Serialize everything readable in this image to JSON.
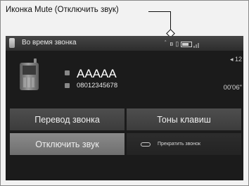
{
  "annotation": {
    "callout_label": "Иконка Mute (Отключить звук)"
  },
  "statusbar": {
    "title": "Во время звонка",
    "mute_icon": "mute-mic-icon",
    "bluetooth_icon": "bluetooth-icon",
    "hfl_icon": "hfl-icon",
    "battery_icon": "battery-icon",
    "signal_icon": "signal-strength-icon"
  },
  "call": {
    "clock": "12",
    "caller_name": "AAAAA",
    "caller_number": "08012345678",
    "duration": "00'06\""
  },
  "buttons": {
    "transfer": "Перевод звонка",
    "key_tones": "Тоны клавиш",
    "mute": "Отключить звук",
    "end_call": "Прекратить звонок"
  }
}
